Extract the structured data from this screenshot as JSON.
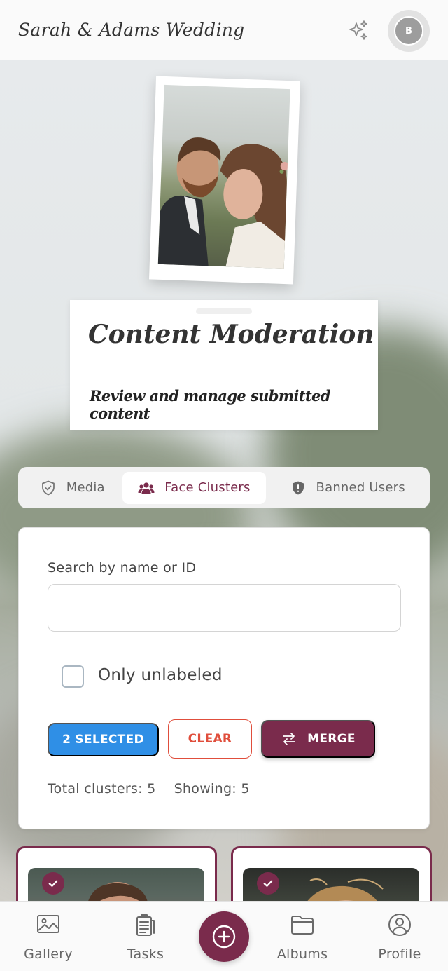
{
  "header": {
    "app_title": "Sarah & Adams Wedding",
    "avatar_initial": "B",
    "sparkle_icon": "sparkle-icon"
  },
  "hero": {
    "photo_icon": "couple-photo",
    "title": "Content Moderation",
    "subtitle": "Review and manage submitted content"
  },
  "tabs": [
    {
      "label": "Media",
      "icon": "shield-check-icon",
      "active": false
    },
    {
      "label": "Face Clusters",
      "icon": "users-icon",
      "active": true
    },
    {
      "label": "Banned Users",
      "icon": "shield-alert-icon",
      "active": false
    }
  ],
  "filters": {
    "search_label": "Search by name or ID",
    "search_value": "",
    "only_unlabeled_label": "Only unlabeled",
    "only_unlabeled_checked": false
  },
  "actions": {
    "selected_label": "2 SELECTED",
    "clear_label": "CLEAR",
    "merge_label": "MERGE"
  },
  "stats": {
    "total_label": "Total clusters: 5",
    "showing_label": "Showing: 5"
  },
  "clusters": [
    {
      "selected": true
    },
    {
      "selected": true
    }
  ],
  "bottom_nav": [
    {
      "label": "Gallery",
      "icon": "image-icon"
    },
    {
      "label": "Tasks",
      "icon": "clipboard-icon"
    },
    {
      "label": "",
      "icon": "plus-circle-icon"
    },
    {
      "label": "Albums",
      "icon": "folder-icon"
    },
    {
      "label": "Profile",
      "icon": "user-circle-icon"
    }
  ],
  "colors": {
    "accent": "#7a2b4c",
    "primary_blue": "#2f8fe6",
    "danger": "#e04e3c"
  }
}
